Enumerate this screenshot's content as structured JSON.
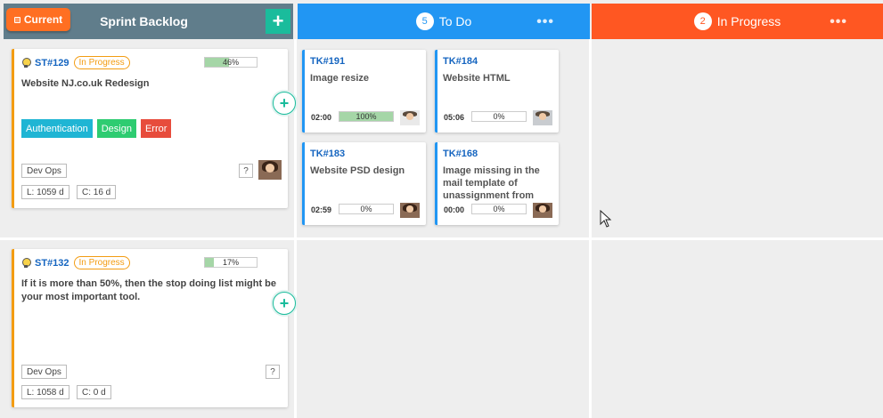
{
  "backlog": {
    "current_label": "Current",
    "title": "Sprint Backlog",
    "add_label": "+"
  },
  "columns": [
    {
      "name": "To Do",
      "count": "5",
      "menu": "•••"
    },
    {
      "name": "In Progress",
      "count": "2",
      "menu": "•••"
    }
  ],
  "stories": [
    {
      "id": "ST#129",
      "status": "In Progress",
      "progress": "46%",
      "progress_value": 46,
      "title": "Website NJ.co.uk Redesign",
      "tags": [
        "Authentication",
        "Design",
        "Error"
      ],
      "team": "Dev Ops",
      "question": "?",
      "lead_time": "L: 1059 d",
      "cycle_time": "C: 16 d"
    },
    {
      "id": "ST#132",
      "status": "In Progress",
      "progress": "17%",
      "progress_value": 17,
      "title": "If it is more than 50%, then the stop doing list might be your most important tool.",
      "tags": [],
      "team": "Dev Ops",
      "question": "?",
      "lead_time": "L: 1058 d",
      "cycle_time": "C: 0 d"
    }
  ],
  "tasks": [
    {
      "id": "TK#191",
      "title": "Image resize",
      "time": "02:00",
      "progress": "100%",
      "progress_value": 100
    },
    {
      "id": "TK#184",
      "title": "Website HTML",
      "time": "05:06",
      "progress": "0%",
      "progress_value": 0
    },
    {
      "id": "TK#183",
      "title": "Website PSD design",
      "time": "02:59",
      "progress": "0%",
      "progress_value": 0
    },
    {
      "id": "TK#168",
      "title": "Image missing in the mail template of unassignment from story",
      "time": "00:00",
      "progress": "0%",
      "progress_value": 0
    }
  ],
  "colors": {
    "backlog_header": "#607d8b",
    "todo_header": "#2196f3",
    "in_progress_header": "#ff5722",
    "current_badge": "#ff6f22",
    "add_button": "#1abc9c",
    "story_border": "#f39c12",
    "task_border": "#2196f3"
  },
  "icons": {
    "current": "square-icon",
    "story": "lightbulb-icon",
    "add_task": "plus-circle-icon",
    "menu": "more-horizontal-icon",
    "cursor": "mouse-pointer-icon"
  }
}
